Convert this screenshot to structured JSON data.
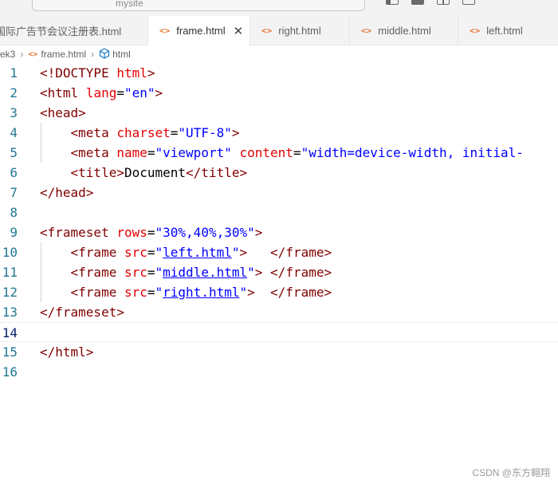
{
  "window": {
    "search_text": "mysite"
  },
  "tabs": [
    {
      "label": "国际广告节会议注册表.html",
      "active": false,
      "closable": false
    },
    {
      "label": "frame.html",
      "active": true,
      "closable": true
    },
    {
      "label": "right.html",
      "active": false,
      "closable": false
    },
    {
      "label": "middle.html",
      "active": false,
      "closable": false
    },
    {
      "label": "left.html",
      "active": false,
      "closable": false
    }
  ],
  "breadcrumb": {
    "folder": "ek3",
    "file": "frame.html",
    "symbol": "html"
  },
  "editor": {
    "line_numbers": [
      "1",
      "2",
      "3",
      "4",
      "5",
      "6",
      "7",
      "8",
      "9",
      "10",
      "11",
      "12",
      "13",
      "14",
      "15",
      "16"
    ],
    "current_line": 14
  },
  "watermark": "CSDN @东方翱翔",
  "colors": {
    "tag": "#800000",
    "attribute": "#e50000",
    "string": "#0000ff",
    "line_number": "#237893"
  }
}
